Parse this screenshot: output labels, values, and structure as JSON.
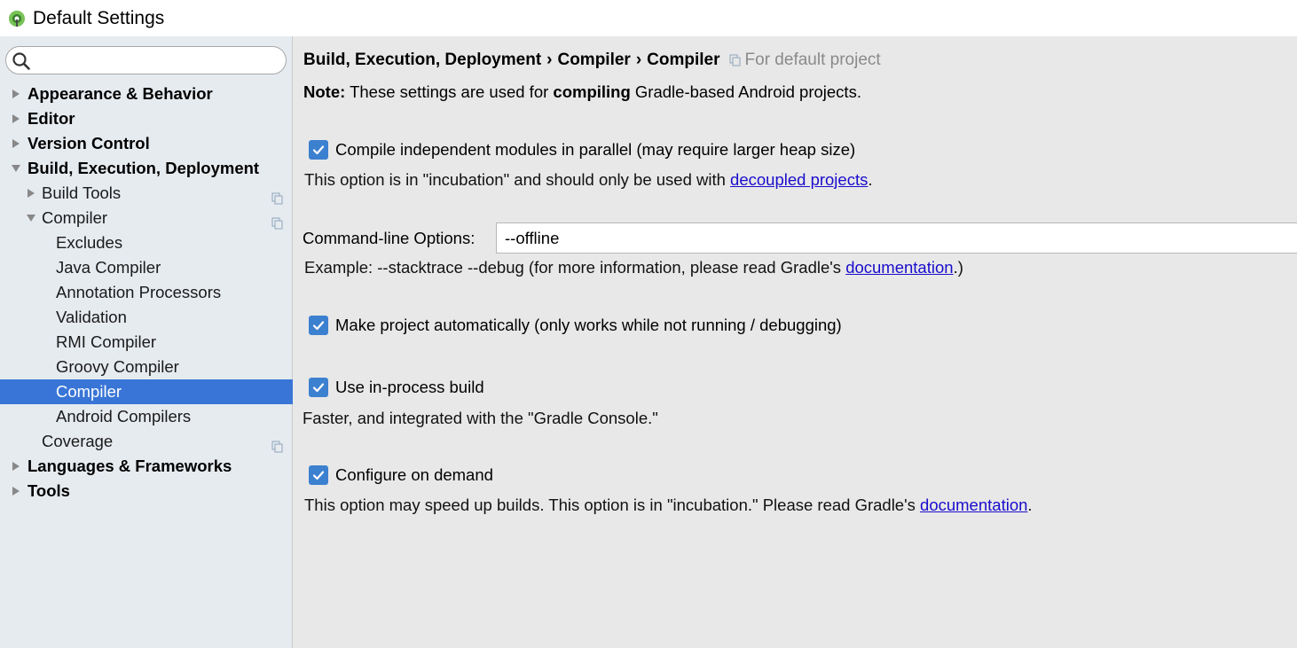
{
  "window": {
    "title": "Default Settings",
    "icon": "android-studio-icon"
  },
  "sidebar": {
    "search": {
      "value": "",
      "placeholder": ""
    },
    "tree": [
      {
        "label": "Appearance & Behavior",
        "level": 0,
        "bold": true,
        "expanded": false,
        "arrow": true
      },
      {
        "label": "Editor",
        "level": 0,
        "bold": true,
        "expanded": false,
        "arrow": true
      },
      {
        "label": "Version Control",
        "level": 0,
        "bold": true,
        "expanded": false,
        "arrow": true
      },
      {
        "label": "Build, Execution, Deployment",
        "level": 0,
        "bold": true,
        "expanded": true,
        "arrow": true
      },
      {
        "label": "Build Tools",
        "level": 1,
        "expanded": false,
        "arrow": true,
        "copy_icon": true
      },
      {
        "label": "Compiler",
        "level": 1,
        "expanded": true,
        "arrow": true,
        "copy_icon": true
      },
      {
        "label": "Excludes",
        "level": 2
      },
      {
        "label": "Java Compiler",
        "level": 2
      },
      {
        "label": "Annotation Processors",
        "level": 2
      },
      {
        "label": "Validation",
        "level": 2
      },
      {
        "label": "RMI Compiler",
        "level": 2
      },
      {
        "label": "Groovy Compiler",
        "level": 2
      },
      {
        "label": "Compiler",
        "level": 2,
        "selected": true
      },
      {
        "label": "Android Compilers",
        "level": 2
      },
      {
        "label": "Coverage",
        "level": 1,
        "copy_icon": true
      },
      {
        "label": "Languages & Frameworks",
        "level": 0,
        "bold": true,
        "expanded": false,
        "arrow": true
      },
      {
        "label": "Tools",
        "level": 0,
        "bold": true,
        "expanded": false,
        "arrow": true
      }
    ]
  },
  "main": {
    "breadcrumb": {
      "parts": [
        "Build, Execution, Deployment",
        "Compiler",
        "Compiler"
      ],
      "separator": "›",
      "scope": "For default project"
    },
    "note": {
      "prefix": "Note:",
      "text_before": " These settings are used for ",
      "emphasis": "compiling",
      "text_after": " Gradle-based Android projects."
    },
    "parallel": {
      "label": "Compile independent modules in parallel (may require larger heap size)",
      "checked": true,
      "desc_before": "This option is in \"incubation\" and should only be used with ",
      "desc_link": "decoupled projects",
      "desc_after": "."
    },
    "command_line": {
      "label": "Command-line Options:",
      "value": "--offline",
      "example_before": "Example: --stacktrace --debug (for more information, please read Gradle's ",
      "example_link": "documentation",
      "example_after": ".)"
    },
    "make_auto": {
      "label": "Make project automatically (only works while not running / debugging)",
      "checked": true
    },
    "in_process": {
      "label": "Use in-process build",
      "checked": true,
      "desc": "Faster, and integrated with the \"Gradle Console.\""
    },
    "on_demand": {
      "label": "Configure on demand",
      "checked": true,
      "desc_before": "This option may speed up builds. This option is in \"incubation.\" Please read Gradle's ",
      "desc_link": "documentation",
      "desc_after": "."
    }
  },
  "colors": {
    "selection": "#3875d7",
    "checkbox": "#3c80d0",
    "link": "#1a0dcc",
    "sidebar_bg": "#e6ebf0",
    "content_bg": "#e8e8e8"
  }
}
